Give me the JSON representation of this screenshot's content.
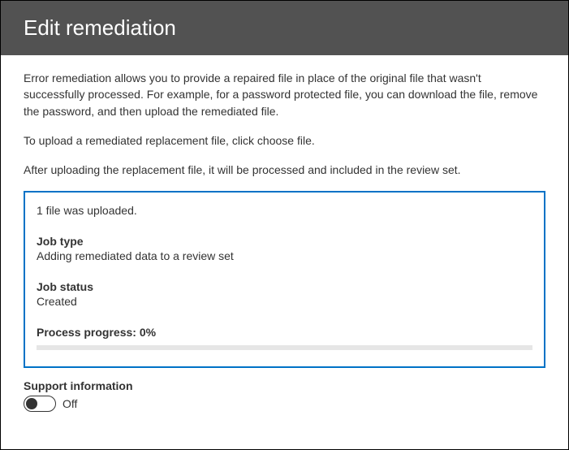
{
  "header": {
    "title": "Edit remediation"
  },
  "description": {
    "p1": "Error remediation allows you to provide a repaired file in place of the original file that wasn't successfully processed. For example, for a password protected file, you can download the file, remove the password, and then upload the remediated file.",
    "p2": "To upload a remediated replacement file, click choose file.",
    "p3": "After uploading the replacement file, it will be processed and included in the review set."
  },
  "statusBox": {
    "uploadedMsg": "1 file was uploaded.",
    "jobTypeLabel": "Job type",
    "jobTypeValue": "Adding remediated data to a review set",
    "jobStatusLabel": "Job status",
    "jobStatusValue": "Created",
    "progressLabel": "Process progress: ",
    "progressValue": "0%"
  },
  "support": {
    "label": "Support information",
    "toggleState": "Off"
  }
}
